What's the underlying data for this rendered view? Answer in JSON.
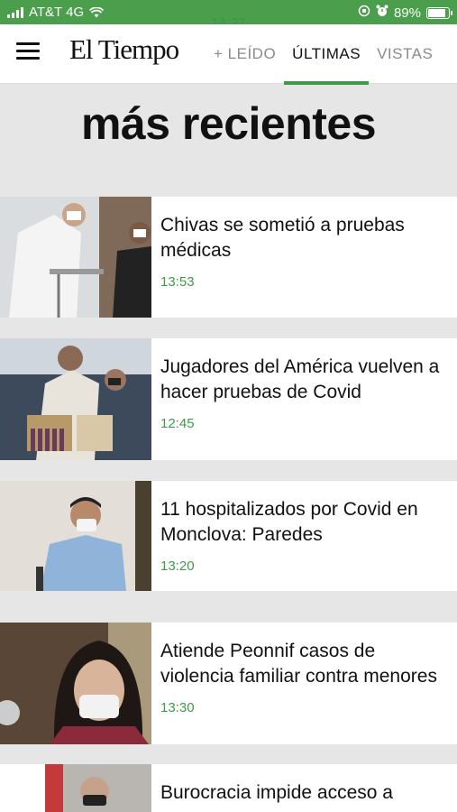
{
  "status_bar": {
    "carrier": "AT&T 4G",
    "time": "14:27",
    "battery": "89%",
    "battery_level": 0.89
  },
  "header": {
    "logo": "El Tiempo",
    "tabs": [
      {
        "label": "+ LEÍDO",
        "active": false
      },
      {
        "label": "ÚLTIMAS",
        "active": true
      },
      {
        "label": "VISTAS",
        "active": false
      }
    ]
  },
  "section": {
    "title": "más recientes"
  },
  "articles": [
    {
      "headline": "Chivas se sometió a pruebas médicas",
      "time": "13:53"
    },
    {
      "headline": "Jugadores del América vuelven a hacer pruebas de Covid",
      "time": "12:45"
    },
    {
      "headline": "11 hospitalizados por Covid en Monclova: Paredes",
      "time": "13:20"
    },
    {
      "headline": "Atiende Peonnif casos de violencia familiar contra menores",
      "time": "13:30"
    },
    {
      "headline": "Burocracia impide acceso a",
      "time": ""
    }
  ],
  "colors": {
    "accent": "#3d9a47",
    "status_bar": "#4b9e4b"
  }
}
